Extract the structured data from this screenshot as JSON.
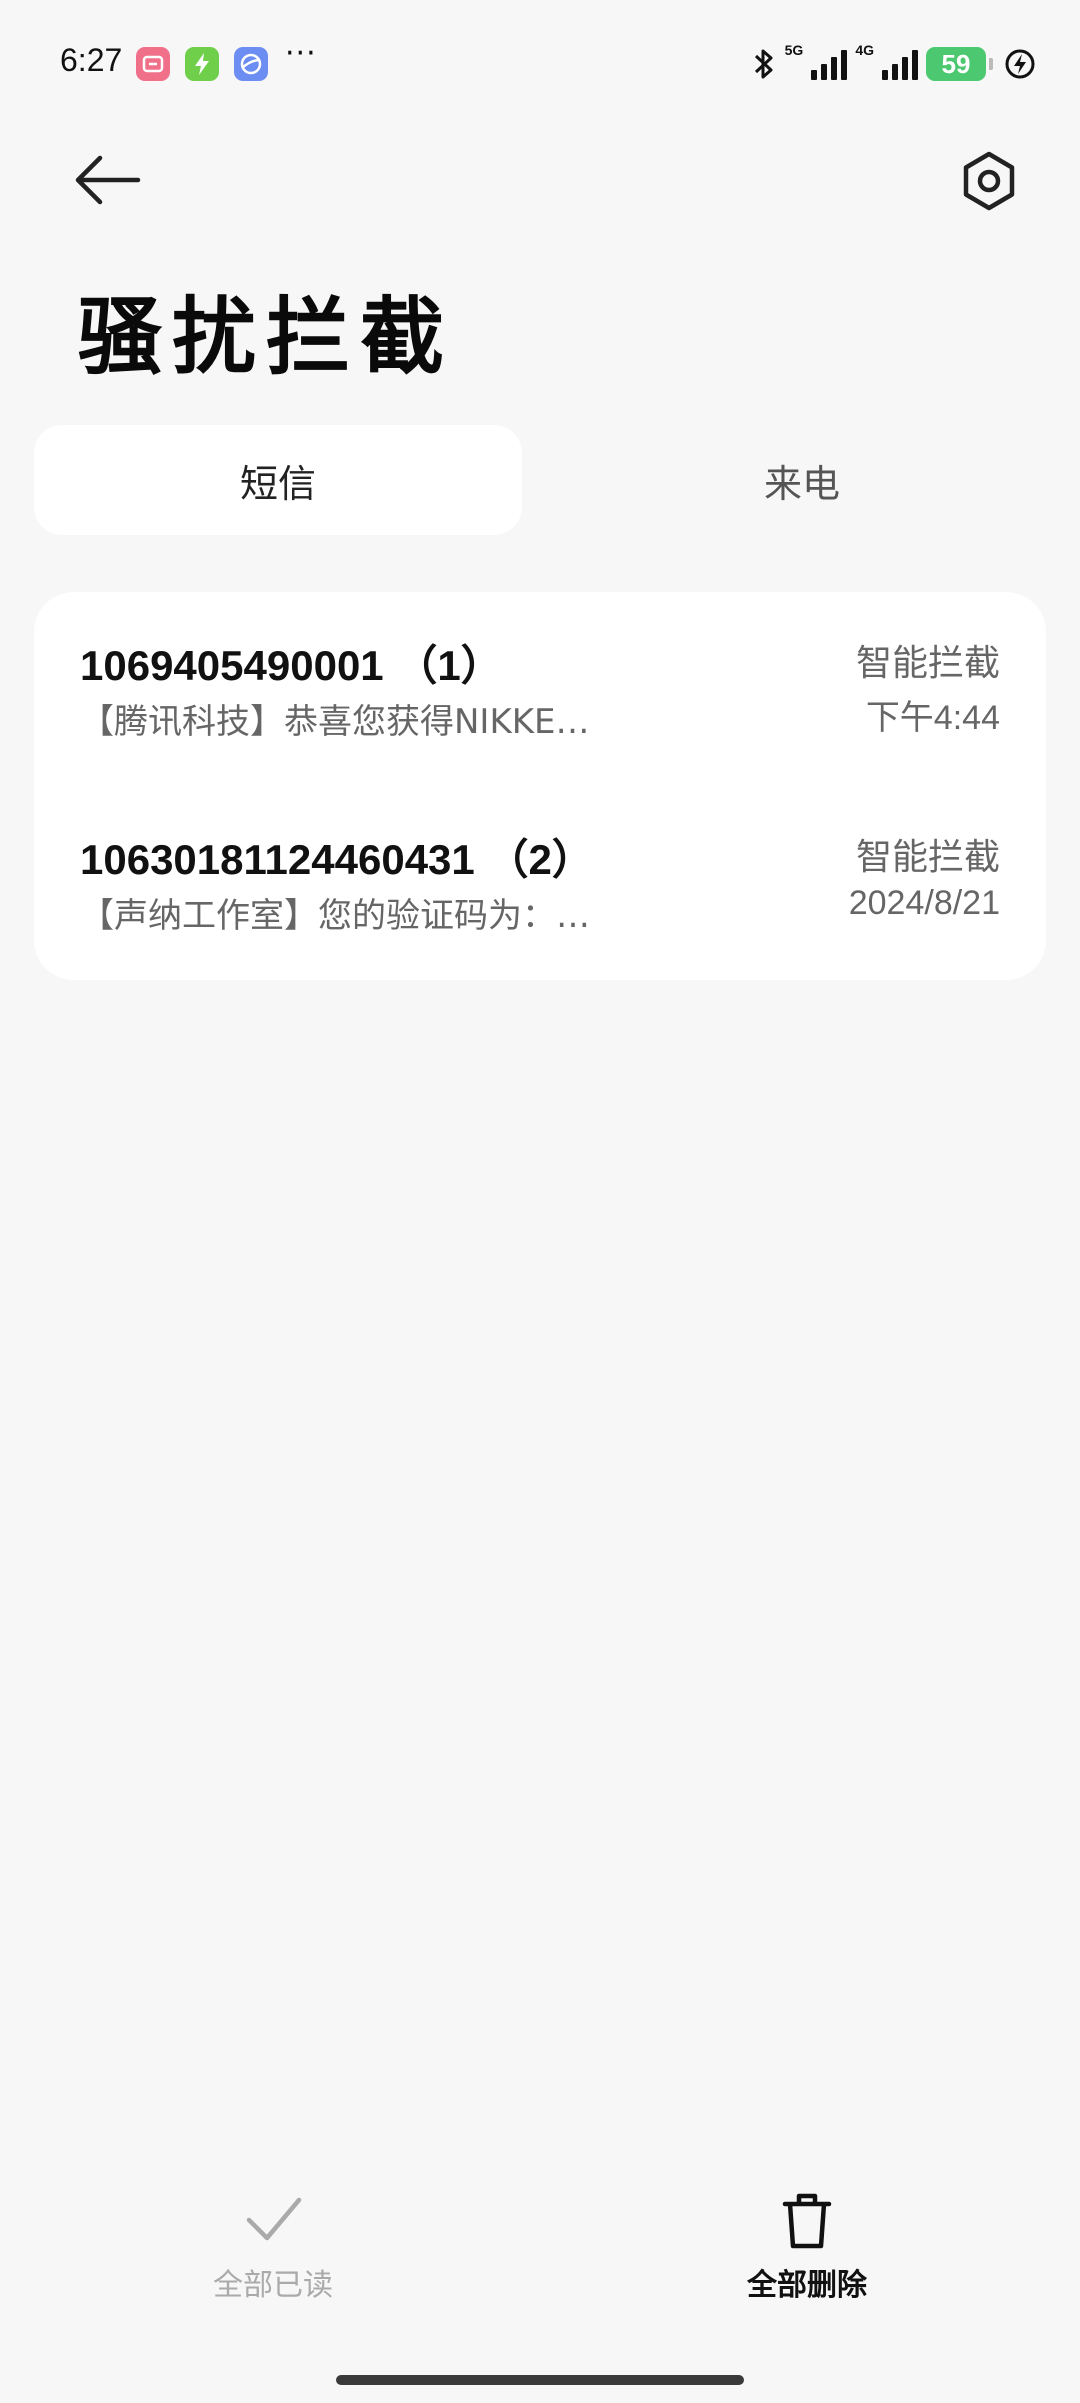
{
  "status_bar": {
    "time": "6:27",
    "more": "···",
    "net1": "5G",
    "net2": "4G",
    "battery": "59"
  },
  "header": {
    "title": "骚扰拦截"
  },
  "tabs": [
    {
      "label": "短信",
      "active": true
    },
    {
      "label": "来电",
      "active": false
    }
  ],
  "messages": [
    {
      "sender": "1069405490001 （1）",
      "preview": "【腾讯科技】恭喜您获得NIKKE…",
      "tag": "智能拦截",
      "time": "下午4:44"
    },
    {
      "sender": "10630181124460431 （2）",
      "preview": "【声纳工作室】您的验证码为：…",
      "tag": "智能拦截",
      "time": "2024/8/21"
    }
  ],
  "actions": {
    "mark_all_read": "全部已读",
    "delete_all": "全部删除"
  },
  "colors": {
    "background": "#f7f7f7",
    "card": "#ffffff",
    "battery": "#4cc970"
  }
}
